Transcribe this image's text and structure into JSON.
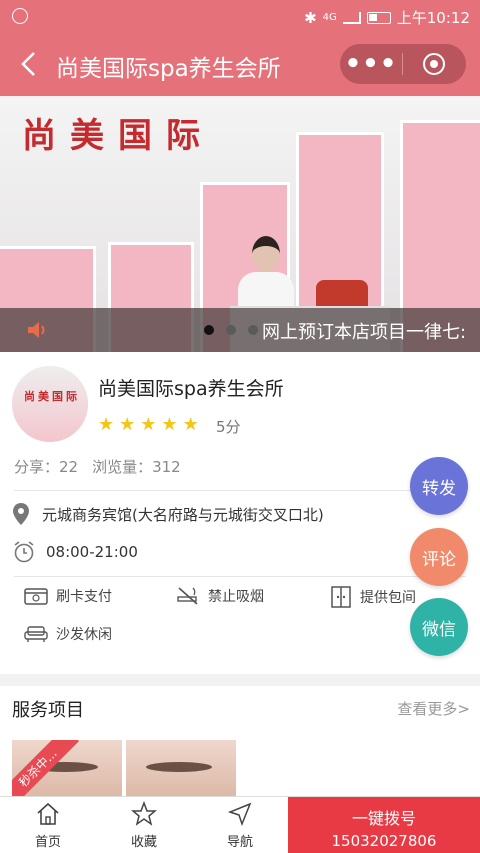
{
  "status": {
    "time": "上午10:12",
    "net": "4G"
  },
  "nav": {
    "title": "尚美国际spa养生会所",
    "more_icon": "more-dots-icon",
    "close_icon": "target-icon"
  },
  "banner": {
    "brand_text": "尚美国际",
    "notice": "网上预订本店项目一律七:",
    "slides": 3,
    "active_slide": 0
  },
  "shop": {
    "name": "尚美国际spa养生会所",
    "rating": 5,
    "score_text": "5分",
    "shares_label": "分享：22",
    "views_label": "浏览量：312",
    "address": "元城商务宾馆(大名府路与元城街交叉口北)",
    "hours": "08:00-21:00",
    "amenities": [
      "刷卡支付",
      "禁止吸烟",
      "提供包间",
      "沙发休闲"
    ]
  },
  "fabs": [
    {
      "label": "转发",
      "color": "#6a74d8"
    },
    {
      "label": "评论",
      "color": "#f08a6a"
    },
    {
      "label": "微信",
      "color": "#2fb3a7"
    }
  ],
  "services": {
    "heading": "服务项目",
    "more": "查看更多>",
    "badge": "秒杀中..."
  },
  "tabbar": {
    "home": "首页",
    "favorite": "收藏",
    "navigate": "导航",
    "call_label": "一键拨号",
    "call_number": "15032027806"
  },
  "colors": {
    "brand": "#e5727a",
    "star": "#f5c518",
    "call": "#e83a45"
  }
}
